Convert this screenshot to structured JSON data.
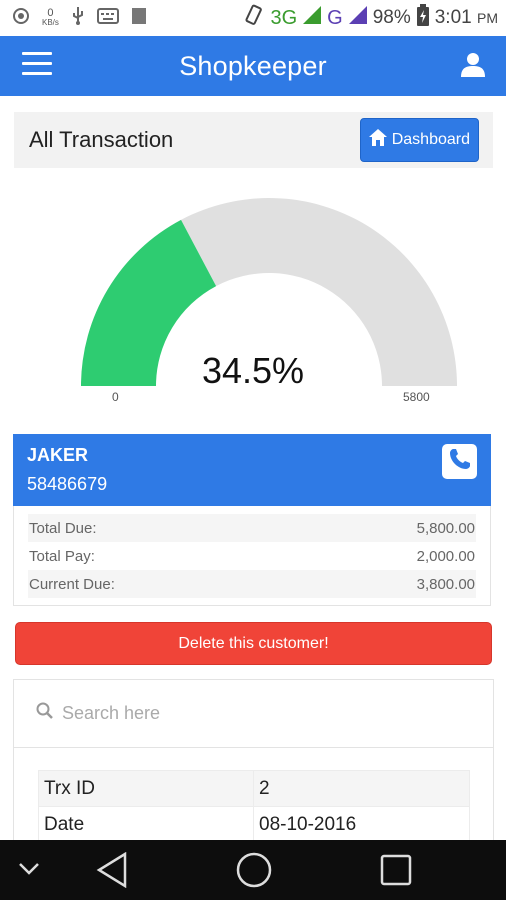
{
  "status_bar": {
    "network1": "3G",
    "network2": "G",
    "battery": "98%",
    "time": "3:01",
    "ampm": "PM",
    "speed_value": "0",
    "speed_unit": "KB/s"
  },
  "app_bar": {
    "title": "Shopkeeper",
    "menu_icon": "hamburger-menu-icon",
    "user_icon": "user-icon",
    "color": "#2f7ae5"
  },
  "header": {
    "title": "All Transaction",
    "dashboard_label": "Dashboard"
  },
  "gauge": {
    "value_text": "34.5%",
    "fraction": 0.345,
    "min_label": "0",
    "max_label": "5800",
    "fill_color": "#2ecc71",
    "track_color": "#e0e0e0"
  },
  "customer": {
    "name": "JAKER",
    "phone": "58486679",
    "call_icon": "phone-icon"
  },
  "summary": [
    {
      "label": "Total Due:",
      "value": "5,800.00"
    },
    {
      "label": "Total Pay:",
      "value": "2,000.00"
    },
    {
      "label": "Current Due:",
      "value": "3,800.00"
    }
  ],
  "delete_label": "Delete this customer!",
  "search": {
    "placeholder": "Search here"
  },
  "transactions": [
    {
      "key": "Trx ID",
      "value": "2"
    },
    {
      "key": "Date",
      "value": "08-10-2016"
    }
  ],
  "nav": {
    "back": "back-icon",
    "home": "home-icon",
    "recents": "recents-icon"
  }
}
